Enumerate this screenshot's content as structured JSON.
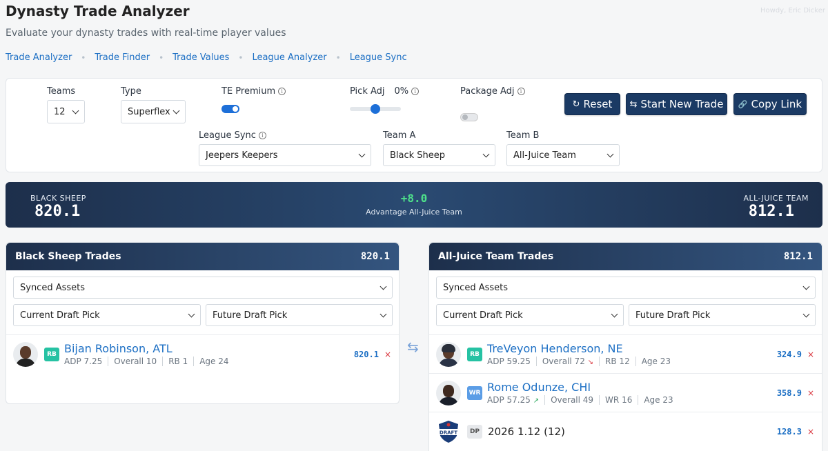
{
  "header": {
    "title": "Dynasty Trade Analyzer",
    "user": "Howdy, Eric Dicker",
    "subtitle": "Evaluate your dynasty trades with real-time player values"
  },
  "nav": [
    "Trade Analyzer",
    "Trade Finder",
    "Trade Values",
    "League Analyzer",
    "League Sync"
  ],
  "settings": {
    "teams_label": "Teams",
    "teams_value": "12",
    "type_label": "Type",
    "type_value": "Superflex",
    "te_premium_label": "TE Premium",
    "te_premium_on": true,
    "pick_adj_label": "Pick Adj",
    "pick_adj_value": "0%",
    "package_adj_label": "Package Adj",
    "package_adj_on": false,
    "league_sync_label": "League Sync",
    "league_sync_value": "Jeepers Keepers",
    "team_a_label": "Team A",
    "team_a_value": "Black Sheep",
    "team_b_label": "Team B",
    "team_b_value": "All-Juice Team"
  },
  "buttons": {
    "reset": "Reset",
    "new_trade": "Start New Trade",
    "copy_link": "Copy Link"
  },
  "summary": {
    "team_a_name": "BLACK SHEEP",
    "team_a_value": "820.1",
    "team_b_name": "ALL-JUICE TEAM",
    "team_b_value": "812.1",
    "advantage": "+8.0",
    "advantage_text": "Advantage All-Juice Team"
  },
  "left": {
    "title": "Black Sheep Trades",
    "total": "820.1",
    "synced": "Synced Assets",
    "current_pick": "Current Draft Pick",
    "future_pick": "Future Draft Pick",
    "players": [
      {
        "pos": "RB",
        "name": "Bijan Robinson, ATL",
        "adp": "ADP 7.25",
        "overall": "Overall 10",
        "rank": "RB 1",
        "age": "Age 24",
        "value": "820.1"
      }
    ]
  },
  "right": {
    "title": "All-Juice Team Trades",
    "total": "812.1",
    "synced": "Synced Assets",
    "current_pick": "Current Draft Pick",
    "future_pick": "Future Draft Pick",
    "players": [
      {
        "pos": "RB",
        "name": "TreVeyon Henderson, NE",
        "adp": "ADP 59.25",
        "overall": "Overall 72",
        "trend": "down",
        "rank": "RB 12",
        "age": "Age 23",
        "value": "324.9"
      },
      {
        "pos": "WR",
        "name": "Rome Odunze, CHI",
        "adp": "ADP 57.25",
        "overall": "Overall 49",
        "trend": "up",
        "rank": "WR 16",
        "age": "Age 23",
        "value": "358.9"
      }
    ],
    "pick": {
      "pos": "DP",
      "name": "2026 1.12 (12)",
      "value": "128.3",
      "logo_text": "DRAFT"
    }
  },
  "icons": {
    "remove": "×",
    "swap": "⇆",
    "reset": "↻",
    "new": "⇆",
    "link": "🔗"
  },
  "colors": {
    "accent": "#1c6fc4",
    "navy": "#1b3a64",
    "positive": "#4ee08a",
    "remove": "#d9363e"
  }
}
